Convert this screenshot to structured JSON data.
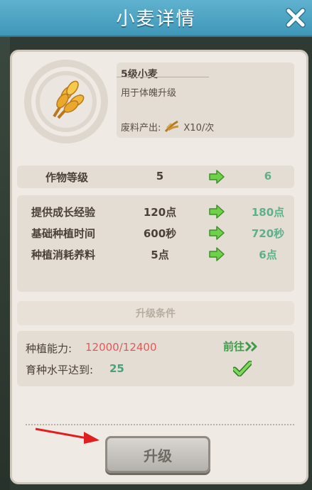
{
  "window": {
    "title": "小麦详情"
  },
  "crop": {
    "name": "5级小麦",
    "description": "用于体魄升级",
    "output_label": "废料产出:",
    "output_value": "X10/次"
  },
  "level_row": {
    "label": "作物等级",
    "current": "5",
    "next": "6"
  },
  "stats": [
    {
      "label": "提供成长经验",
      "current": "120点",
      "next": "180点"
    },
    {
      "label": "基础种植时间",
      "current": "600秒",
      "next": "720秒"
    },
    {
      "label": "种植消耗养料",
      "current": "5点",
      "next": "6点"
    }
  ],
  "conditions": {
    "title": "升级条件",
    "items": [
      {
        "label": "种植能力:",
        "value": "12000/12400",
        "value_color": "#e05a5a",
        "action": "前往"
      },
      {
        "label": "育种水平达到:",
        "value": "25",
        "value_color": "#4aa07c"
      }
    ]
  },
  "buttons": {
    "upgrade": "升级"
  },
  "icons": {
    "close": "close-icon",
    "crop": "wheat-icon",
    "output": "scrap-icon",
    "arrow": "green-arrow-icon",
    "go": "double-chevron-icon",
    "check": "checkmark-icon"
  },
  "colors": {
    "header": "#4ba3c3",
    "next_value": "#5fb08a",
    "insufficient": "#e05a5a",
    "met": "#4aa07c"
  }
}
